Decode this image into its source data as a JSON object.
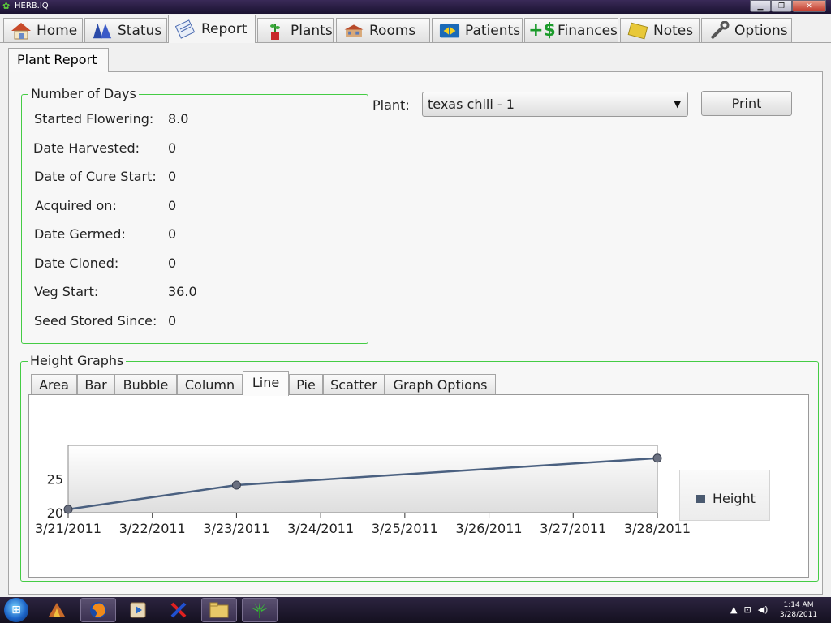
{
  "window": {
    "title": "HERB.IQ"
  },
  "nav": {
    "tabs": [
      {
        "label": "Home",
        "icon": "house-icon"
      },
      {
        "label": "Status",
        "icon": "status-icon"
      },
      {
        "label": "Report",
        "icon": "report-icon"
      },
      {
        "label": "Plants",
        "icon": "plant-icon"
      },
      {
        "label": "Rooms",
        "icon": "building-icon"
      },
      {
        "label": "Patients",
        "icon": "patients-icon"
      },
      {
        "label": "Finances",
        "icon": "money-icon"
      },
      {
        "label": "Notes",
        "icon": "notepad-icon"
      },
      {
        "label": "Options",
        "icon": "wrench-icon"
      }
    ],
    "active": "Report"
  },
  "subtab": {
    "label": "Plant Report"
  },
  "days": {
    "title": "Number of Days",
    "rows": [
      {
        "label": "Started Flowering:",
        "value": "8.0"
      },
      {
        "label": "Date Harvested:",
        "value": "0"
      },
      {
        "label": "Date of Cure Start:",
        "value": "0"
      },
      {
        "label": "Acquired on:",
        "value": "0"
      },
      {
        "label": "Date Germed:",
        "value": "0"
      },
      {
        "label": "Date Cloned:",
        "value": "0"
      },
      {
        "label": "Veg Start:",
        "value": "36.0"
      },
      {
        "label": "Seed Stored Since:",
        "value": "0"
      }
    ]
  },
  "plant": {
    "label": "Plant:",
    "selected": "texas chili - 1"
  },
  "print_label": "Print",
  "graphs": {
    "title": "Height Graphs",
    "tabs": [
      "Area",
      "Bar",
      "Bubble",
      "Column",
      "Line",
      "Pie",
      "Scatter",
      "Graph Options"
    ],
    "active": "Line"
  },
  "chart_data": {
    "type": "line",
    "title": "",
    "xlabel": "",
    "ylabel": "",
    "x": [
      "3/21/2011",
      "3/23/2011",
      "3/28/2011"
    ],
    "x_ticks": [
      "3/21/2011",
      "3/22/2011",
      "3/23/2011",
      "3/24/2011",
      "3/25/2011",
      "3/26/2011",
      "3/27/2011",
      "3/28/2011"
    ],
    "y_ticks": [
      20,
      25
    ],
    "ylim": [
      20,
      30
    ],
    "series": [
      {
        "name": "Height",
        "values": [
          20.5,
          24.1,
          28.1
        ],
        "color": "#4a6080"
      }
    ],
    "grid": true,
    "legend_position": "right"
  },
  "taskbar": {
    "items": [
      "app-icon",
      "firefox-icon",
      "media-player-icon",
      "x-app-icon",
      "folder-icon",
      "herbiq-icon"
    ],
    "time": "1:14 AM",
    "date": "3/28/2011"
  }
}
